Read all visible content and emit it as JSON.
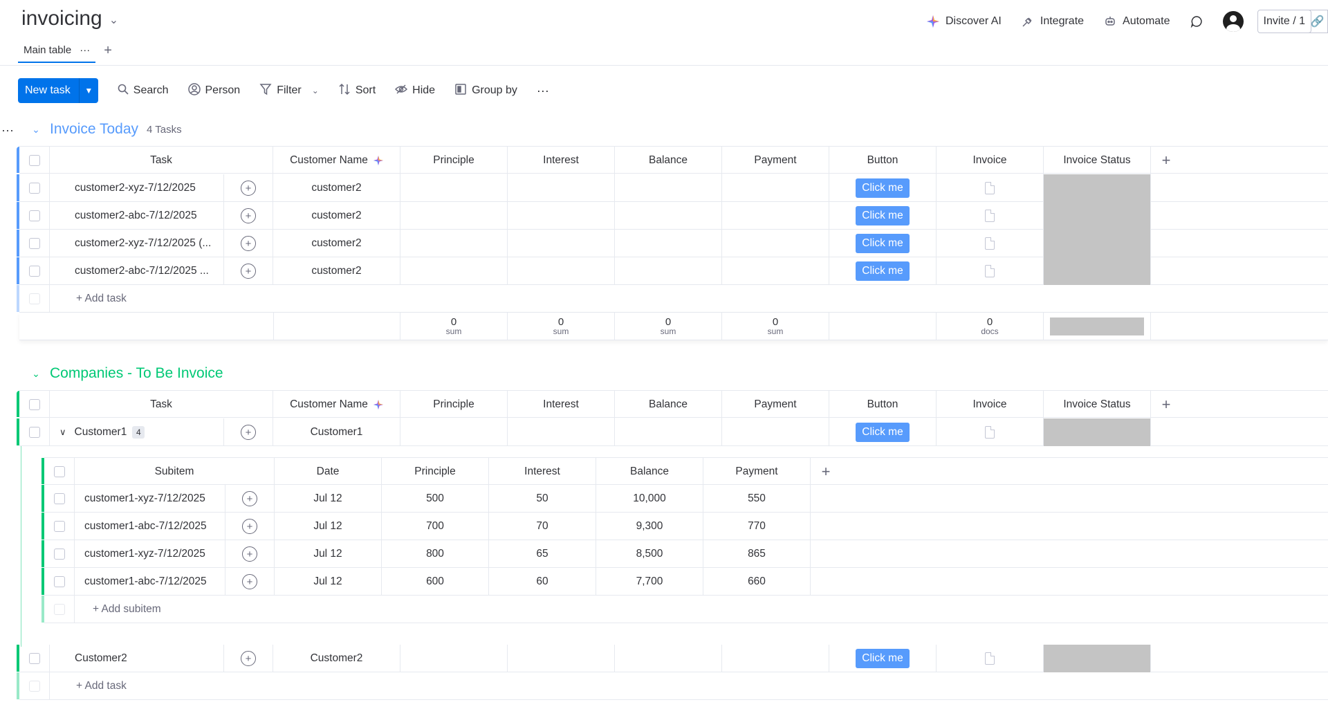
{
  "board": {
    "title": "invoicing"
  },
  "top_actions": {
    "discover_ai": "Discover AI",
    "integrate": "Integrate",
    "automate": "Automate",
    "invite": "Invite / 1"
  },
  "views": {
    "main_table": "Main table"
  },
  "toolbar": {
    "new_task": "New task",
    "search": "Search",
    "person": "Person",
    "filter": "Filter",
    "sort": "Sort",
    "hide": "Hide",
    "group_by": "Group by"
  },
  "columns": {
    "task": "Task",
    "customer_name": "Customer Name",
    "principle": "Principle",
    "interest": "Interest",
    "balance": "Balance",
    "payment": "Payment",
    "button": "Button",
    "invoice": "Invoice",
    "invoice_status": "Invoice Status"
  },
  "button_label": "Click me",
  "add_task": "+ Add task",
  "add_subitem": "+ Add subitem",
  "group1": {
    "name": "Invoice Today",
    "count": "4 Tasks",
    "color": "#579bfc",
    "rows": [
      {
        "task": "customer2-xyz-7/12/2025",
        "customer": "customer2"
      },
      {
        "task": "customer2-abc-7/12/2025",
        "customer": "customer2"
      },
      {
        "task": "customer2-xyz-7/12/2025 (...",
        "customer": "customer2"
      },
      {
        "task": "customer2-abc-7/12/2025 ...",
        "customer": "customer2"
      }
    ],
    "summary": {
      "principle": "0",
      "interest": "0",
      "balance": "0",
      "payment": "0",
      "invoice": "0",
      "sum_label": "sum",
      "docs_label": "docs"
    }
  },
  "group2": {
    "name": "Companies - To Be Invoice",
    "color": "#00c875",
    "rows": [
      {
        "task": "Customer1",
        "subitem_count": "4",
        "customer": "Customer1"
      },
      {
        "task": "Customer2",
        "customer": "Customer2"
      }
    ],
    "subitems": {
      "columns": {
        "subitem": "Subitem",
        "date": "Date",
        "principle": "Principle",
        "interest": "Interest",
        "balance": "Balance",
        "payment": "Payment"
      },
      "rows": [
        {
          "name": "customer1-xyz-7/12/2025",
          "date": "Jul 12",
          "principle": "500",
          "interest": "50",
          "balance": "10,000",
          "payment": "550"
        },
        {
          "name": "customer1-abc-7/12/2025",
          "date": "Jul 12",
          "principle": "700",
          "interest": "70",
          "balance": "9,300",
          "payment": "770"
        },
        {
          "name": "customer1-xyz-7/12/2025",
          "date": "Jul 12",
          "principle": "800",
          "interest": "65",
          "balance": "8,500",
          "payment": "865"
        },
        {
          "name": "customer1-abc-7/12/2025",
          "date": "Jul 12",
          "principle": "600",
          "interest": "60",
          "balance": "7,700",
          "payment": "660"
        }
      ]
    }
  }
}
